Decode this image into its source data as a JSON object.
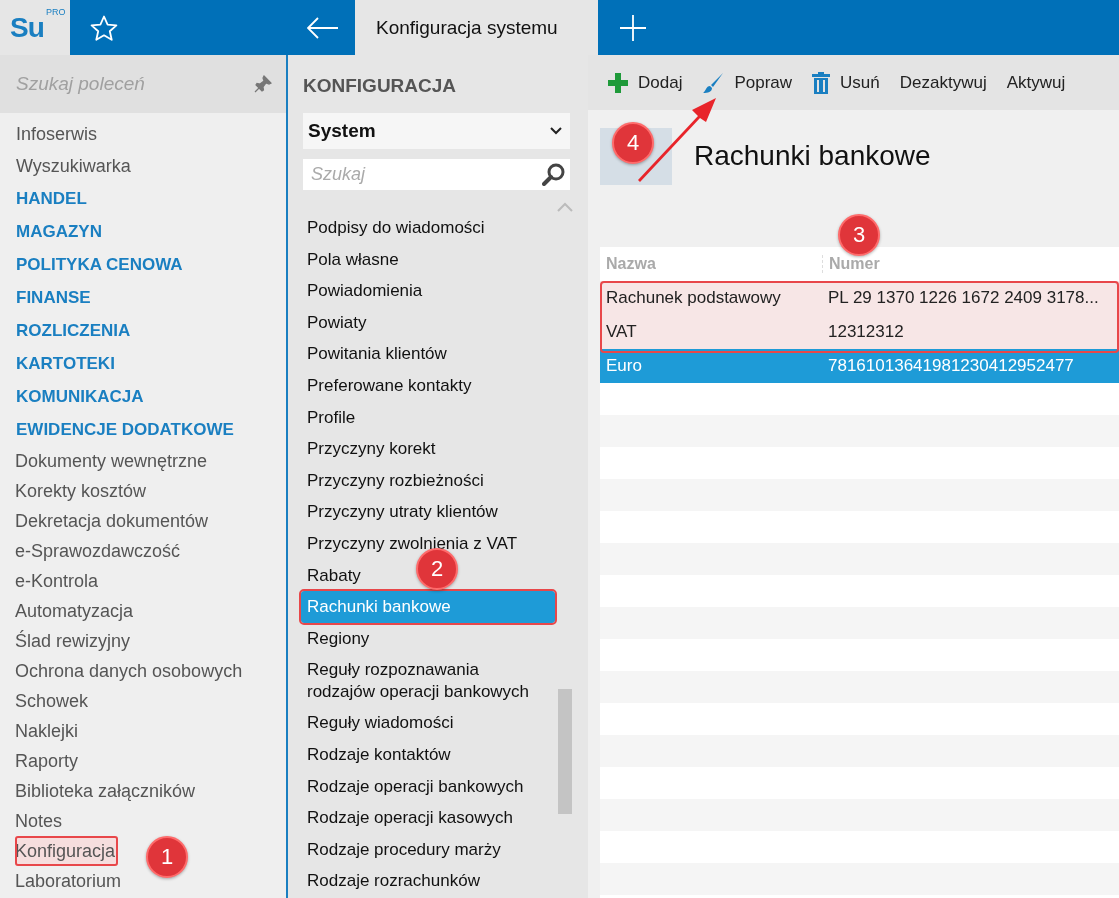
{
  "app": {
    "logo": "Su",
    "logo_badge": "PRO"
  },
  "tabs": [
    {
      "label": "Konfiguracja systemu",
      "selected": true
    }
  ],
  "sidebar": {
    "search": {
      "placeholder": "Szukaj poleceń"
    },
    "items": [
      {
        "label": "Infoserwis",
        "kind": "link",
        "outlined": false
      },
      {
        "label": "Wyszukiwarka",
        "kind": "link",
        "outlined": false
      },
      {
        "label": "HANDEL",
        "kind": "category",
        "outlined": false
      },
      {
        "label": "MAGAZYN",
        "kind": "category",
        "outlined": false
      },
      {
        "label": "POLITYKA CENOWA",
        "kind": "category",
        "outlined": false
      },
      {
        "label": "FINANSE",
        "kind": "category",
        "outlined": false
      },
      {
        "label": "ROZLICZENIA",
        "kind": "category",
        "outlined": false
      },
      {
        "label": "KARTOTEKI",
        "kind": "category",
        "outlined": false
      },
      {
        "label": "KOMUNIKACJA",
        "kind": "category",
        "outlined": false
      },
      {
        "label": "EWIDENCJE DODATKOWE",
        "kind": "category",
        "outlined": false
      },
      {
        "label": "Dokumenty wewnętrzne",
        "kind": "sub",
        "outlined": false
      },
      {
        "label": "Korekty kosztów",
        "kind": "sub",
        "outlined": false
      },
      {
        "label": "Dekretacja dokumentów",
        "kind": "sub",
        "outlined": false
      },
      {
        "label": "e-Sprawozdawczość",
        "kind": "sub",
        "outlined": false
      },
      {
        "label": "e-Kontrola",
        "kind": "sub",
        "outlined": false
      },
      {
        "label": "Automatyzacja",
        "kind": "sub",
        "outlined": false
      },
      {
        "label": "Ślad rewizyjny",
        "kind": "sub",
        "outlined": false
      },
      {
        "label": "Ochrona danych osobowych",
        "kind": "sub",
        "outlined": false
      },
      {
        "label": "Schowek",
        "kind": "sub",
        "outlined": false
      },
      {
        "label": "Naklejki",
        "kind": "sub",
        "outlined": false
      },
      {
        "label": "Raporty",
        "kind": "sub",
        "outlined": false
      },
      {
        "label": "Biblioteka załączników",
        "kind": "sub",
        "outlined": false
      },
      {
        "label": "Notes",
        "kind": "sub",
        "outlined": false
      },
      {
        "label": "Konfiguracja",
        "kind": "sub",
        "outlined": true
      },
      {
        "label": "Laboratorium",
        "kind": "sub",
        "outlined": false
      }
    ]
  },
  "config": {
    "title": "KONFIGURACJA",
    "group": "System",
    "search": {
      "placeholder": "Szukaj"
    },
    "items": [
      {
        "label": "Podpisy do wiadomości",
        "selected": false
      },
      {
        "label": "Pola własne",
        "selected": false
      },
      {
        "label": "Powiadomienia",
        "selected": false
      },
      {
        "label": "Powiaty",
        "selected": false
      },
      {
        "label": "Powitania klientów",
        "selected": false
      },
      {
        "label": "Preferowane kontakty",
        "selected": false
      },
      {
        "label": "Profile",
        "selected": false
      },
      {
        "label": "Przyczyny korekt",
        "selected": false
      },
      {
        "label": "Przyczyny rozbieżności",
        "selected": false
      },
      {
        "label": "Przyczyny utraty klientów",
        "selected": false
      },
      {
        "label": "Przyczyny zwolnienia z VAT",
        "selected": false
      },
      {
        "label": "Rabaty",
        "selected": false
      },
      {
        "label": "Rachunki bankowe",
        "selected": true
      },
      {
        "label": "Regiony",
        "selected": false
      },
      {
        "label": "Reguły rozpoznawania rodzajów operacji bankowych",
        "selected": false
      },
      {
        "label": "Reguły wiadomości",
        "selected": false
      },
      {
        "label": "Rodzaje kontaktów",
        "selected": false
      },
      {
        "label": "Rodzaje operacji bankowych",
        "selected": false
      },
      {
        "label": "Rodzaje operacji kasowych",
        "selected": false
      },
      {
        "label": "Rodzaje procedury marży",
        "selected": false
      },
      {
        "label": "Rodzaje rozrachunków",
        "selected": false
      }
    ]
  },
  "toolbar": [
    {
      "label": "Dodaj",
      "kind": "add"
    },
    {
      "label": "Popraw",
      "kind": "edit"
    },
    {
      "label": "Usuń",
      "kind": "delete"
    },
    {
      "label": "Dezaktywuj",
      "kind": "text"
    },
    {
      "label": "Aktywuj",
      "kind": "text"
    }
  ],
  "page": {
    "title": "Rachunki bankowe"
  },
  "table": {
    "columns": [
      "Nazwa",
      "Numer"
    ],
    "rows": [
      {
        "cells": [
          "Rachunek podstawowy",
          "PL 29 1370 1226 1672 2409 3178..."
        ],
        "selected": false,
        "outlined": true
      },
      {
        "cells": [
          "VAT",
          "12312312"
        ],
        "selected": false,
        "outlined": true
      },
      {
        "cells": [
          "Euro",
          "78161013641981230412952477"
        ],
        "selected": true,
        "outlined": false
      }
    ]
  },
  "annotations": [
    {
      "number": "1"
    },
    {
      "number": "2"
    },
    {
      "number": "3"
    },
    {
      "number": "4"
    }
  ]
}
